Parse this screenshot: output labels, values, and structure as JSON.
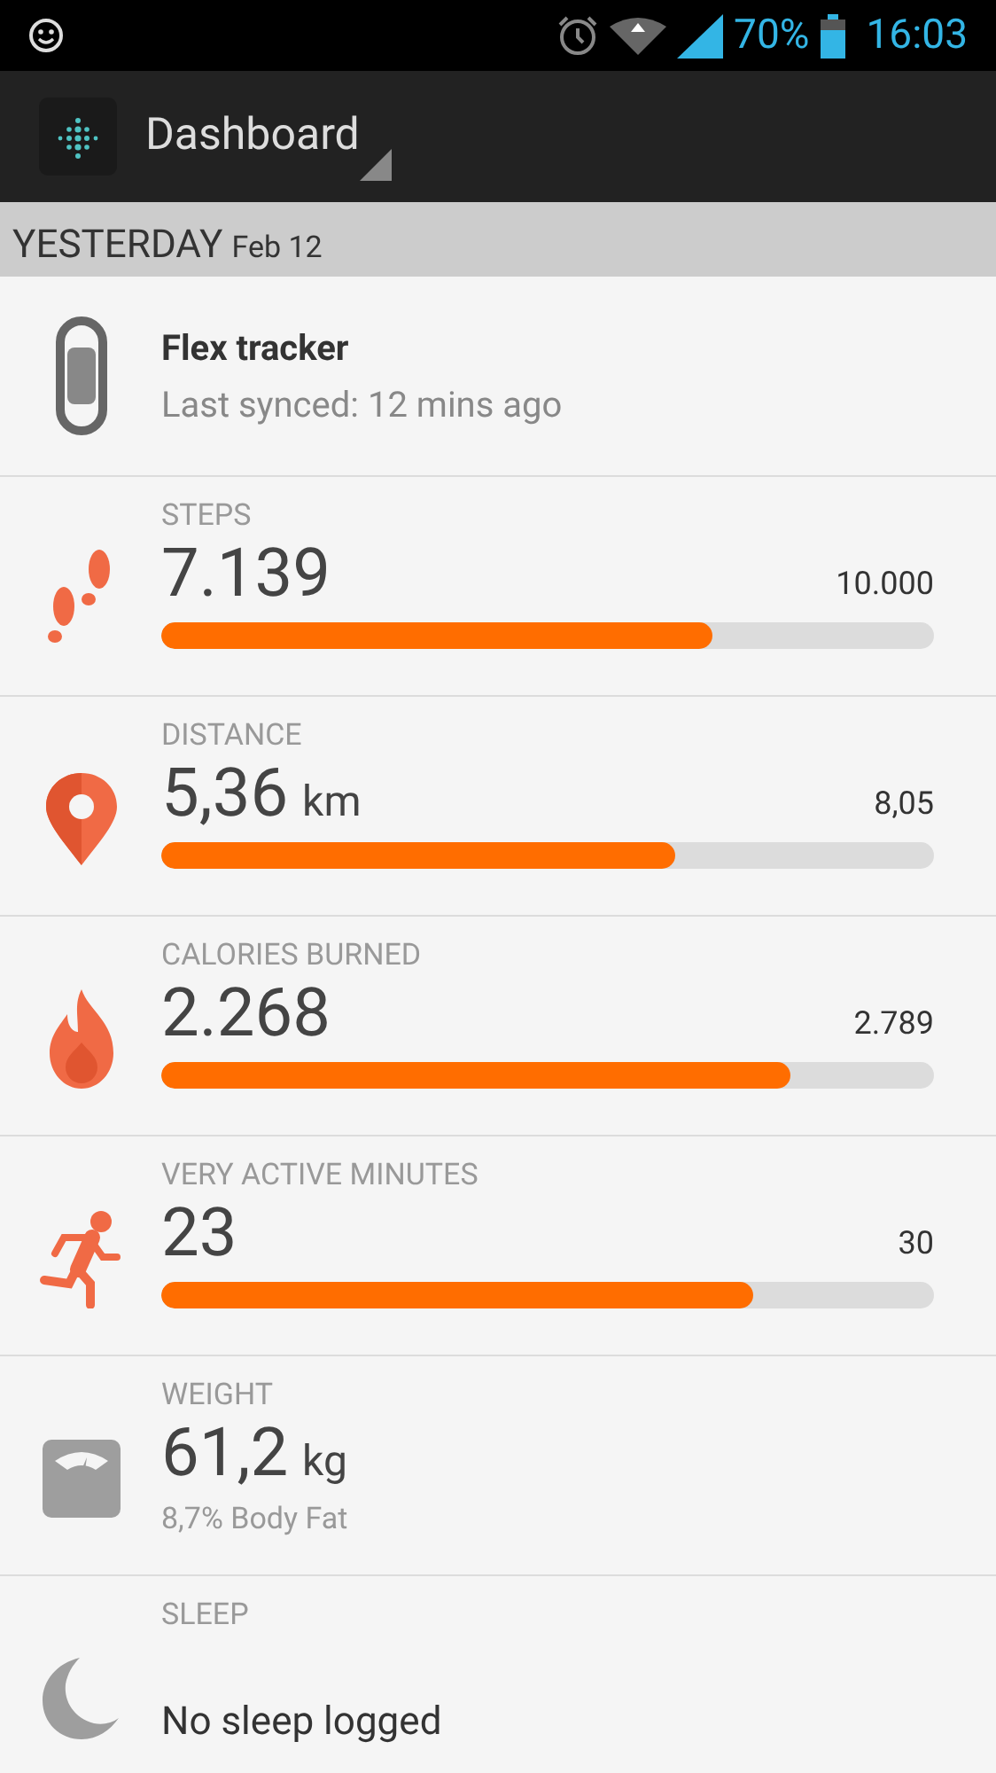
{
  "status_bar": {
    "battery": "70%",
    "time": "16:03"
  },
  "action_bar": {
    "title": "Dashboard"
  },
  "section": {
    "title": "YESTERDAY",
    "date": "Feb 12"
  },
  "device": {
    "name": "Flex tracker",
    "synced": "Last synced: 12 mins ago"
  },
  "tiles": [
    {
      "kind": "progress",
      "label": "STEPS",
      "value": "7.139",
      "goal": "10.000",
      "level": 0.713
    },
    {
      "kind": "progress",
      "label": "DISTANCE",
      "value": "5,36",
      "unit": "km",
      "goal": "8,05",
      "level": 0.665
    },
    {
      "kind": "progress",
      "label": "CALORIES BURNED",
      "value": "2.268",
      "goal": "2.789",
      "level": 0.814
    },
    {
      "kind": "progress",
      "label": "VERY ACTIVE MINUTES",
      "value": "23",
      "goal": "30",
      "level": 0.766
    },
    {
      "kind": "weight",
      "label": "WEIGHT",
      "value": "61,2",
      "unit": "kg",
      "detail": "8,7% Body Fat"
    },
    {
      "kind": "sleep",
      "label": "SLEEP",
      "message": "No sleep logged"
    }
  ]
}
